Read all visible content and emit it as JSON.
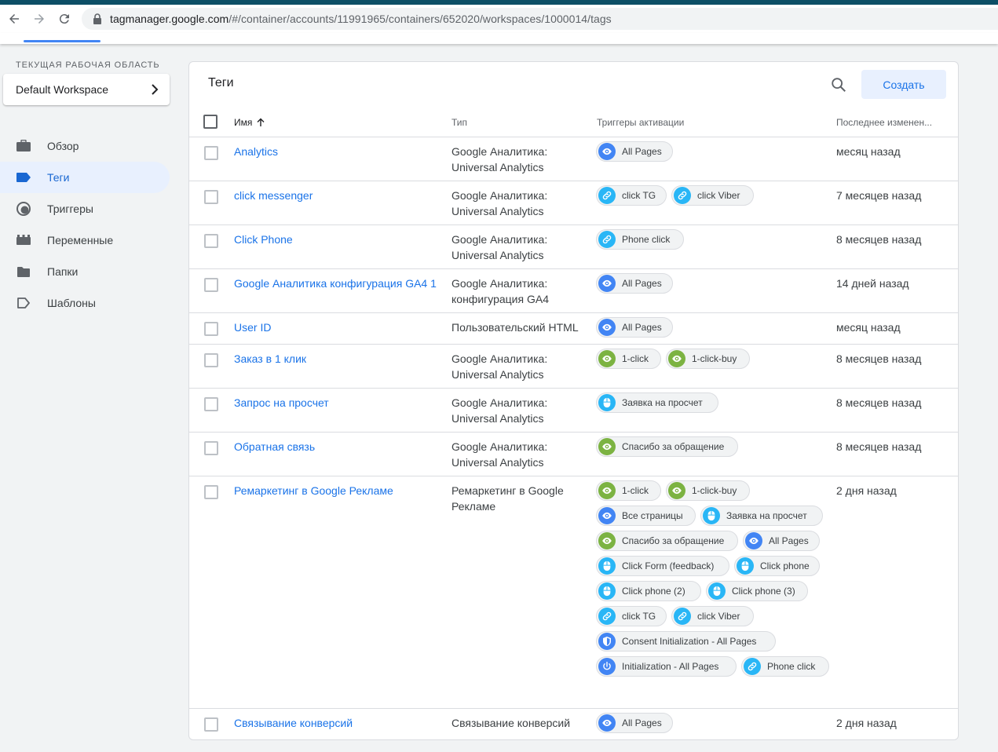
{
  "browser": {
    "url_domain": "tagmanager.google.com",
    "url_path": "/#/container/accounts/11991965/containers/652020/workspaces/1000014/tags"
  },
  "sidebar": {
    "workspace_label": "ТЕКУЩАЯ РАБОЧАЯ ОБЛАСТЬ",
    "workspace_name": "Default Workspace",
    "items": [
      {
        "label": "Обзор",
        "icon": "briefcase-icon"
      },
      {
        "label": "Теги",
        "icon": "tag-icon"
      },
      {
        "label": "Триггеры",
        "icon": "trigger-icon"
      },
      {
        "label": "Переменные",
        "icon": "variables-icon"
      },
      {
        "label": "Папки",
        "icon": "folder-icon"
      },
      {
        "label": "Шаблоны",
        "icon": "label-outline-icon"
      }
    ]
  },
  "main": {
    "title": "Теги",
    "create_label": "Создать",
    "columns": {
      "name": "Имя",
      "type": "Тип",
      "triggers": "Триггеры активации",
      "edited": "Последнее изменен..."
    }
  },
  "colors": {
    "accent": "#1a73e8",
    "view": "#4285f4",
    "link": "#29b6f6",
    "green": "#7cb342"
  },
  "rows": [
    {
      "name": "Analytics",
      "type": "Google Аналитика: Universal Analytics",
      "edited": "месяц назад",
      "triggers": [
        {
          "label": "All Pages",
          "icon": "eye-icon",
          "color": "#4285f4"
        }
      ]
    },
    {
      "name": "click messenger",
      "type": "Google Аналитика: Universal Analytics",
      "edited": "7 месяцев назад",
      "triggers": [
        {
          "label": "click TG",
          "icon": "link-icon",
          "color": "#29b6f6"
        },
        {
          "label": "click Viber",
          "icon": "link-icon",
          "color": "#29b6f6"
        }
      ]
    },
    {
      "name": "Click Phone",
      "type": "Google Аналитика: Universal Analytics",
      "edited": "8 месяцев назад",
      "triggers": [
        {
          "label": "Phone click",
          "icon": "link-icon",
          "color": "#29b6f6"
        }
      ]
    },
    {
      "name": "Google Аналитика конфигурация GA4 1",
      "type": "Google Аналитика: конфигурация GA4",
      "edited": "14 дней назад",
      "triggers": [
        {
          "label": "All Pages",
          "icon": "eye-icon",
          "color": "#4285f4"
        }
      ]
    },
    {
      "name": "User ID",
      "type": "Пользовательский HTML",
      "edited": "месяц назад",
      "triggers": [
        {
          "label": "All Pages",
          "icon": "eye-icon",
          "color": "#4285f4"
        }
      ]
    },
    {
      "name": "Заказ в 1 клик",
      "type": "Google Аналитика: Universal Analytics",
      "edited": "8 месяцев назад",
      "triggers": [
        {
          "label": "1-click",
          "icon": "eye-icon",
          "color": "#7cb342"
        },
        {
          "label": "1-click-buy",
          "icon": "eye-icon",
          "color": "#7cb342"
        }
      ]
    },
    {
      "name": "Запрос на просчет",
      "type": "Google Аналитика: Universal Analytics",
      "edited": "8 месяцев назад",
      "triggers": [
        {
          "label": "Заявка на просчет",
          "icon": "mouse-icon",
          "color": "#29b6f6"
        }
      ]
    },
    {
      "name": "Обратная связь",
      "type": "Google Аналитика: Universal Analytics",
      "edited": "8 месяцев назад",
      "triggers": [
        {
          "label": "Спасибо за обращение",
          "icon": "eye-icon",
          "color": "#7cb342"
        }
      ]
    },
    {
      "name": "Ремаркетинг в Google Рекламе",
      "type": "Ремаркетинг в Google Рекламе",
      "edited": "2 дня назад",
      "triggers": [
        {
          "label": "1-click",
          "icon": "eye-icon",
          "color": "#7cb342"
        },
        {
          "label": "1-click-buy",
          "icon": "eye-icon",
          "color": "#7cb342"
        },
        {
          "label": "Все страницы",
          "icon": "eye-icon",
          "color": "#4285f4"
        },
        {
          "label": "Заявка на просчет",
          "icon": "mouse-icon",
          "color": "#29b6f6"
        },
        {
          "label": "Спасибо за обращение",
          "icon": "eye-icon",
          "color": "#7cb342"
        },
        {
          "label": "All Pages",
          "icon": "eye-icon",
          "color": "#4285f4"
        },
        {
          "label": "Click Form (feedback)",
          "icon": "mouse-icon",
          "color": "#29b6f6"
        },
        {
          "label": "Click phone",
          "icon": "mouse-icon",
          "color": "#29b6f6"
        },
        {
          "label": "Click phone (2)",
          "icon": "mouse-icon",
          "color": "#29b6f6"
        },
        {
          "label": "Click phone (3)",
          "icon": "mouse-icon",
          "color": "#29b6f6"
        },
        {
          "label": "click TG",
          "icon": "link-icon",
          "color": "#29b6f6"
        },
        {
          "label": "click Viber",
          "icon": "link-icon",
          "color": "#29b6f6"
        },
        {
          "label": "Consent Initialization - All Pages",
          "icon": "shield-icon",
          "color": "#4285f4"
        },
        {
          "label": "Initialization - All Pages",
          "icon": "power-icon",
          "color": "#4285f4"
        },
        {
          "label": "Phone click",
          "icon": "link-icon",
          "color": "#29b6f6"
        }
      ]
    },
    {
      "name": "Связывание конверсий",
      "type": "Связывание конверсий",
      "edited": "2 дня назад",
      "triggers": [
        {
          "label": "All Pages",
          "icon": "eye-icon",
          "color": "#4285f4"
        }
      ]
    }
  ]
}
